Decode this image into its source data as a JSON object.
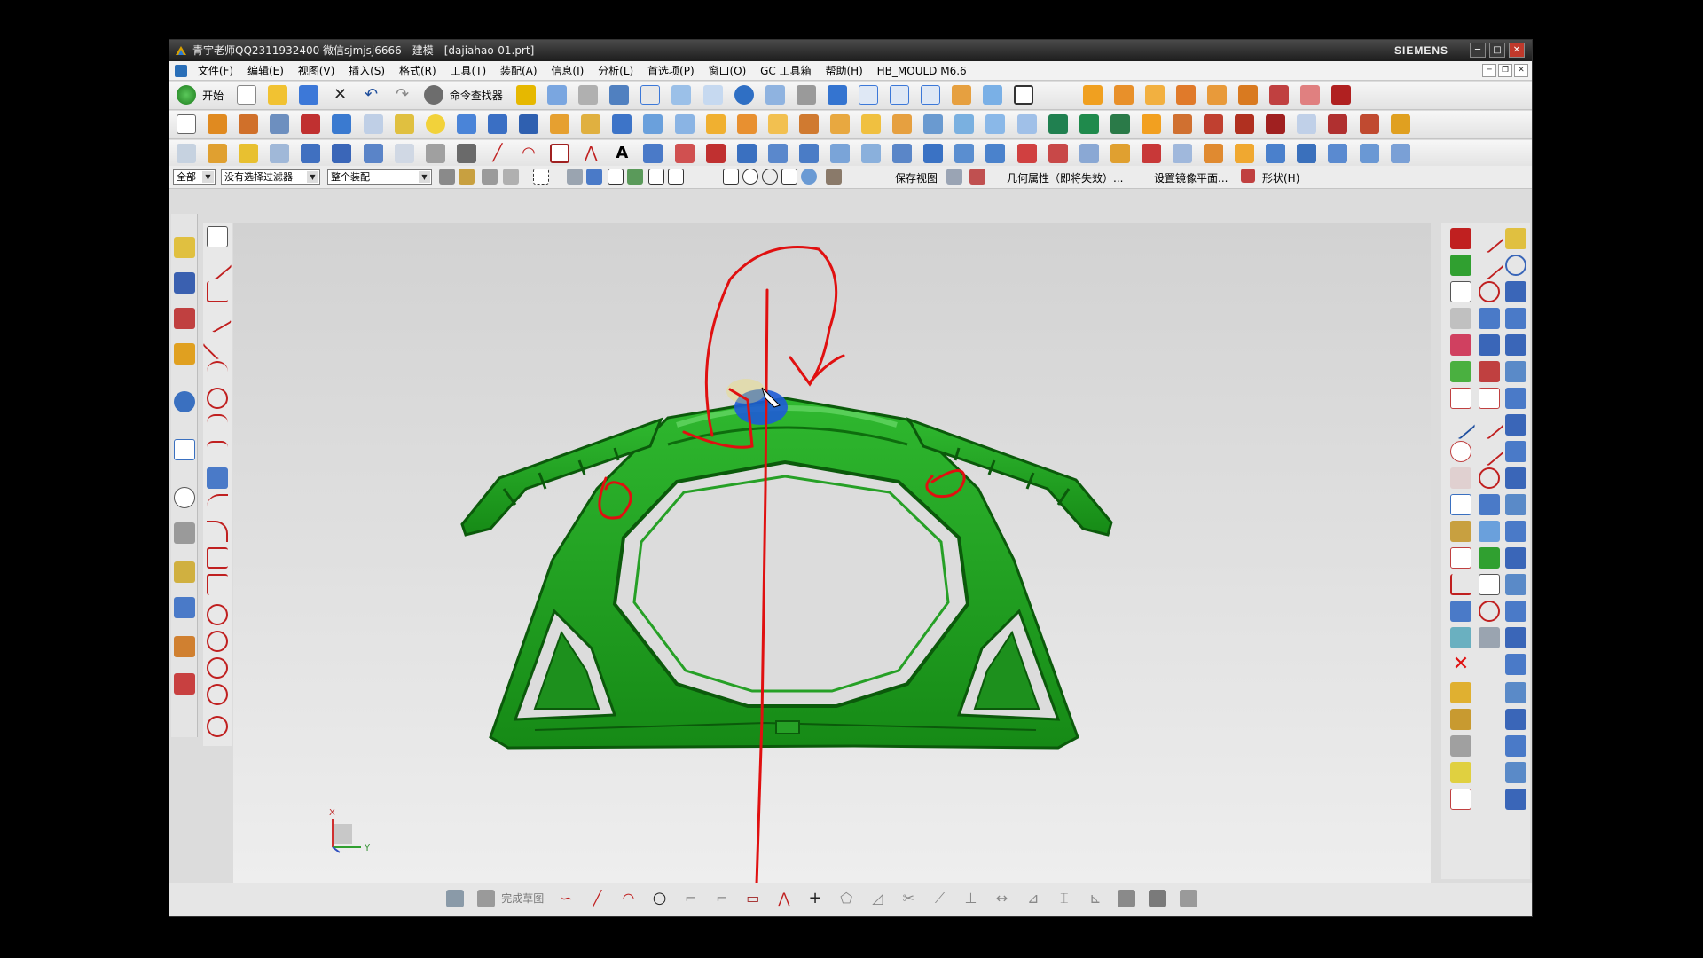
{
  "titlebar": {
    "title": "青宇老师QQ2311932400 微信sjmjsj6666 - 建模 - [dajiahao-01.prt]",
    "brand": "SIEMENS",
    "minimize": "─",
    "maximize": "□",
    "close": "✕"
  },
  "menu": {
    "items": [
      "文件(F)",
      "编辑(E)",
      "视图(V)",
      "插入(S)",
      "格式(R)",
      "工具(T)",
      "装配(A)",
      "信息(I)",
      "分析(L)",
      "首选项(P)",
      "窗口(O)",
      "GC 工具箱",
      "帮助(H)",
      "HB_MOULD M6.6"
    ]
  },
  "toolbar": {
    "start": "开始",
    "command_finder": "命令查找器"
  },
  "selection": {
    "filter_type": "全部",
    "filter": "没有选择过滤器",
    "scope": "整个装配",
    "save_view": "保存视图",
    "geometry_property": "几何属性（即将失效）...",
    "mirror_plane": "设置镜像平面...",
    "shape": "形状(H)"
  },
  "sketch": {
    "finish": "完成草图"
  },
  "triad": {
    "x_label": "X",
    "y_label": "Y"
  },
  "colors": {
    "part_green": "#1fa31f",
    "part_dark": "#0e6d0e",
    "highlight_blue": "#1e5bd6",
    "annotation_red": "#e01010",
    "titlebar": "#2a2a2a"
  }
}
